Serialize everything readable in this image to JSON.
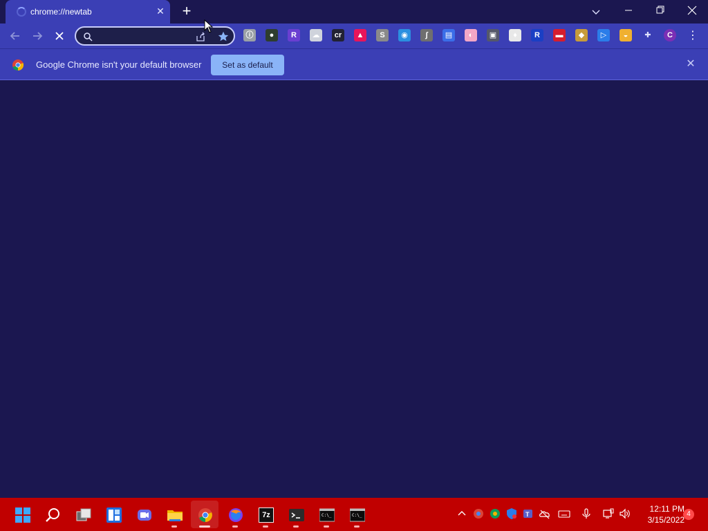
{
  "window": {
    "tab": {
      "title": "chrome://newtab"
    },
    "controls": [
      "minimize",
      "restore",
      "close"
    ]
  },
  "toolbar": {
    "omnibox": {
      "value": "",
      "placeholder": ""
    },
    "extensions": [
      {
        "name": "extension-1",
        "letter": "ⓘ",
        "color": "#9aa0a6"
      },
      {
        "name": "extension-2",
        "letter": "●",
        "color": "#2e3d2e"
      },
      {
        "name": "extension-3",
        "letter": "R",
        "color": "#6a3fd1"
      },
      {
        "name": "extension-4",
        "letter": "☁",
        "color": "#cfd3dc"
      },
      {
        "name": "extension-5",
        "letter": "cr",
        "color": "#223"
      },
      {
        "name": "extension-6",
        "letter": "▲",
        "color": "#e8155a"
      },
      {
        "name": "extension-7",
        "letter": "S",
        "color": "#8a8a8a"
      },
      {
        "name": "extension-8",
        "letter": "◉",
        "color": "#2b8fe0"
      },
      {
        "name": "extension-9",
        "letter": "∫",
        "color": "#6f6f6f"
      },
      {
        "name": "extension-10",
        "letter": "▤",
        "color": "#3a6ee8"
      },
      {
        "name": "extension-11",
        "letter": "◐",
        "color": "#f3a7c6"
      },
      {
        "name": "extension-12",
        "letter": "▣",
        "color": "#55586a"
      },
      {
        "name": "extension-13",
        "letter": "♦",
        "color": "#e8e8e8"
      },
      {
        "name": "extension-14",
        "letter": "R",
        "color": "#1a3fc4"
      },
      {
        "name": "extension-15",
        "letter": "▬",
        "color": "#d61d2d"
      },
      {
        "name": "extension-16",
        "letter": "◆",
        "color": "#c79b3a"
      },
      {
        "name": "extension-17",
        "letter": "▷",
        "color": "#2b7de9"
      },
      {
        "name": "extension-18",
        "letter": "◒",
        "color": "#f0b030"
      },
      {
        "name": "extensions-puzzle",
        "letter": "✚",
        "color": "#dfe1ff"
      },
      {
        "name": "profile",
        "letter": "C",
        "color": "#7b2fb5"
      }
    ]
  },
  "infobar": {
    "message": "Google Chrome isn't your default browser",
    "button_label": "Set as default"
  },
  "taskbar": {
    "apps": [
      {
        "name": "start",
        "icon": "windows-logo",
        "active": false,
        "running": false
      },
      {
        "name": "search",
        "icon": "search-icon",
        "active": false,
        "running": false
      },
      {
        "name": "task-view",
        "icon": "task-view-icon",
        "active": false,
        "running": false
      },
      {
        "name": "widgets",
        "icon": "widgets-icon",
        "active": false,
        "running": false
      },
      {
        "name": "teams-chat",
        "icon": "teams-chat-icon",
        "active": false,
        "running": false
      },
      {
        "name": "file-explorer",
        "icon": "folder-icon",
        "active": false,
        "running": true
      },
      {
        "name": "chrome",
        "icon": "chrome-icon",
        "active": true,
        "running": true
      },
      {
        "name": "firefox",
        "icon": "firefox-icon",
        "active": false,
        "running": true
      },
      {
        "name": "7zip",
        "icon": "7zip-icon",
        "label": "7z",
        "active": false,
        "running": true
      },
      {
        "name": "terminal",
        "icon": "terminal-icon",
        "active": false,
        "running": true
      },
      {
        "name": "cmd-1",
        "icon": "cmd-icon",
        "active": false,
        "running": true
      },
      {
        "name": "cmd-2",
        "icon": "cmd-icon",
        "active": false,
        "running": true
      }
    ],
    "clock": {
      "time": "12:11 PM",
      "date": "3/15/2022"
    },
    "notifications": "4"
  }
}
